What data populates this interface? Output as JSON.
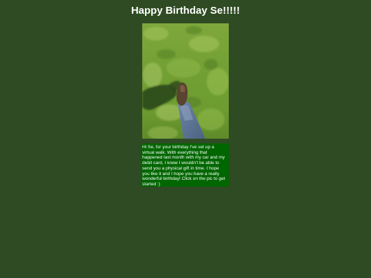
{
  "page": {
    "title": "Happy Birthday Se!!!!!"
  },
  "photo": {
    "icon": "walking-on-grass-photo",
    "alt": "Photo of a foot walking on grass"
  },
  "message": {
    "text": "Hi Se, for your birthday I've set up a virtual walk. With everything that happened last month with my car and my debit card, I knew I wouldn't be able to send you a physical gift in time. I hope you like it and I hope you have a really wonderful birthday! Click on the pic to get started :)"
  },
  "colors": {
    "background": "#2f4b23",
    "message_background": "#006600",
    "text": "#ffffff"
  }
}
